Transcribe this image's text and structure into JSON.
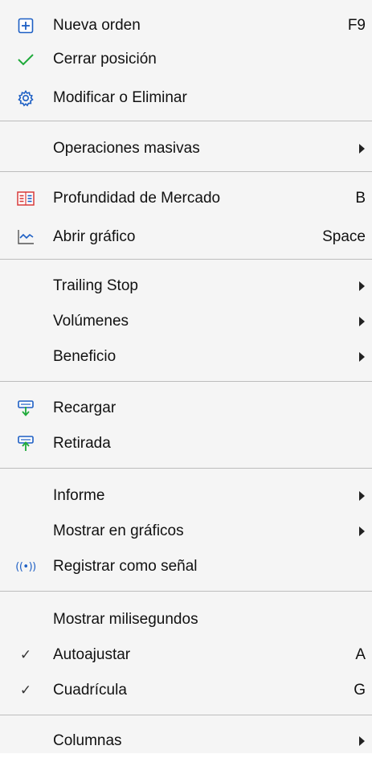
{
  "menu": {
    "items": [
      {
        "label": "Nueva orden",
        "shortcut": "F9",
        "icon": "plus-square-icon"
      },
      {
        "label": "Cerrar posición",
        "icon": "checkmark-icon"
      },
      {
        "label": "Modificar o Eliminar",
        "icon": "gear-icon"
      },
      {
        "label": "Operaciones masivas",
        "submenu": true
      },
      {
        "label": "Profundidad de Mercado",
        "shortcut": "B",
        "icon": "market-depth-icon"
      },
      {
        "label": "Abrir gráfico",
        "shortcut": "Space",
        "icon": "chart-icon"
      },
      {
        "label": "Trailing Stop",
        "submenu": true
      },
      {
        "label": "Volúmenes",
        "submenu": true
      },
      {
        "label": "Beneficio",
        "submenu": true
      },
      {
        "label": "Recargar",
        "icon": "deposit-icon"
      },
      {
        "label": "Retirada",
        "icon": "withdraw-icon"
      },
      {
        "label": "Informe",
        "submenu": true
      },
      {
        "label": "Mostrar en gráficos",
        "submenu": true
      },
      {
        "label": "Registrar como señal",
        "icon": "signal-icon",
        "icon_text": "((•))"
      },
      {
        "label": "Mostrar milisegundos"
      },
      {
        "label": "Autoajustar",
        "shortcut": "A",
        "checked": true,
        "check_glyph": "✓"
      },
      {
        "label": "Cuadrícula",
        "shortcut": "G",
        "checked": true,
        "check_glyph": "✓"
      },
      {
        "label": "Columnas",
        "submenu": true
      }
    ]
  },
  "colors": {
    "background": "#f5f5f5",
    "separator": "#bdbdbd",
    "accent_blue": "#1d5fc4",
    "accent_green": "#1faa3a",
    "accent_red": "#d83b3b"
  }
}
